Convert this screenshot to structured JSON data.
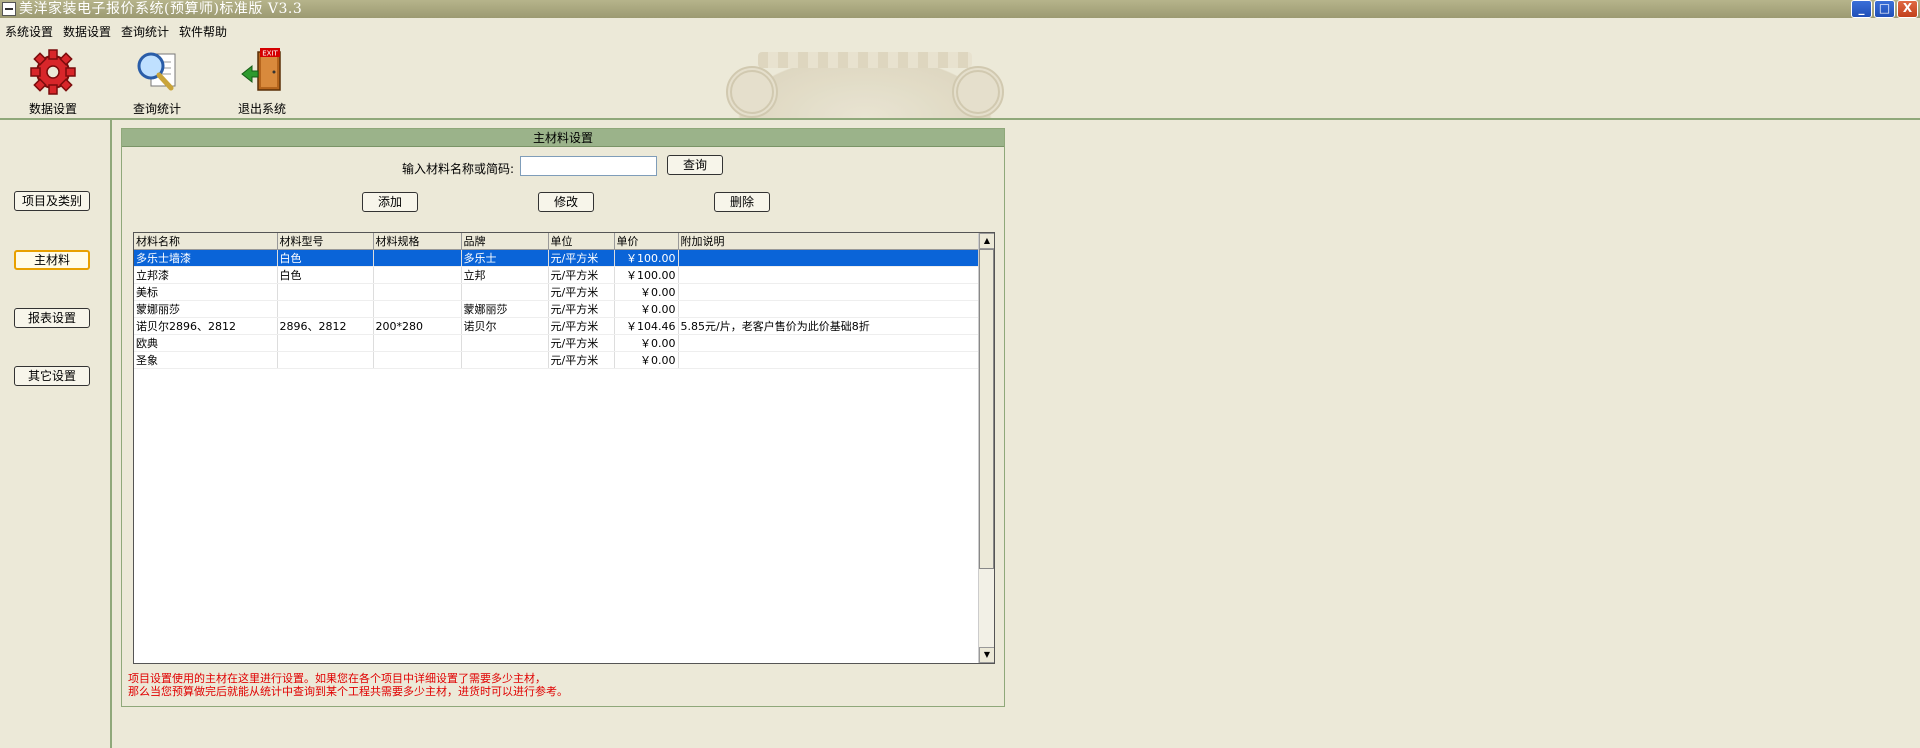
{
  "window": {
    "title": "美洋家装电子报价系统(预算师)标准版 V3.3",
    "min_label": "_",
    "max_label": "□",
    "close_label": "X"
  },
  "menu": [
    "系统设置",
    "数据设置",
    "查询统计",
    "软件帮助"
  ],
  "toolbar": {
    "data_settings": "数据设置",
    "query_stats": "查询统计",
    "exit_system": "退出系统"
  },
  "sidebar": {
    "items": [
      {
        "label": "项目及类别"
      },
      {
        "label": "主材料"
      },
      {
        "label": "报表设置"
      },
      {
        "label": "其它设置"
      }
    ]
  },
  "panel": {
    "title": "主材料设置",
    "search_label": "输入材料名称或简码:",
    "search_value": "",
    "query_label": "查询",
    "add_label": "添加",
    "edit_label": "修改",
    "delete_label": "删除"
  },
  "table": {
    "headers": [
      "材料名称",
      "材料型号",
      "材料规格",
      "品牌",
      "单位",
      "单价",
      "附加说明"
    ],
    "rows": [
      [
        "多乐士墙漆",
        "白色",
        "",
        "多乐士",
        "元/平方米",
        "￥100.00",
        ""
      ],
      [
        "立邦漆",
        "白色",
        "",
        "立邦",
        "元/平方米",
        "￥100.00",
        ""
      ],
      [
        "美标",
        "",
        "",
        "",
        "元/平方米",
        "￥0.00",
        ""
      ],
      [
        "蒙娜丽莎",
        "",
        "",
        "蒙娜丽莎",
        "元/平方米",
        "￥0.00",
        ""
      ],
      [
        "诺贝尔2896、2812",
        "2896、2812",
        "200*280",
        "诺贝尔",
        "元/平方米",
        "￥104.46",
        "5.85元/片，老客户售价为此价基础8折"
      ],
      [
        "欧典",
        "",
        "",
        "",
        "元/平方米",
        "￥0.00",
        ""
      ],
      [
        "圣象",
        "",
        "",
        "",
        "元/平方米",
        "￥0.00",
        ""
      ]
    ],
    "selected_row": 0
  },
  "note": {
    "line1": "项目设置使用的主材在这里进行设置。如果您在各个项目中详细设置了需要多少主材，",
    "line2": "那么当您预算做完后就能从统计中查询到某个工程共需要多少主材，进货时可以进行参考。"
  }
}
